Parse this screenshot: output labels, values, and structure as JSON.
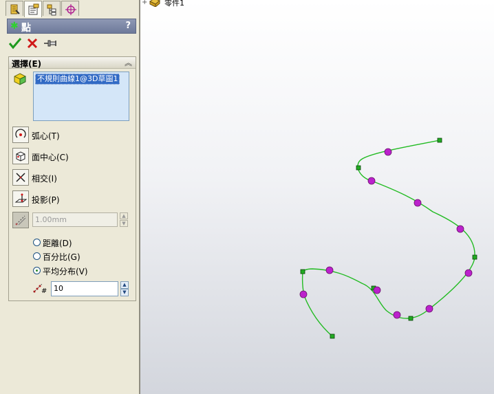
{
  "panel": {
    "tabs": [
      {
        "name": "feature-manager",
        "icon": "feature-manager-icon"
      },
      {
        "name": "property-manager",
        "icon": "property-manager-icon",
        "active": true
      },
      {
        "name": "configuration-manager",
        "icon": "configuration-manager-icon"
      },
      {
        "name": "dim-xpert-manager",
        "icon": "dim-xpert-icon"
      }
    ],
    "title": "點",
    "help": "?",
    "selection_group": {
      "title": "選擇(E)",
      "selected_item": "不規則曲線1@3D草圖1"
    },
    "options": [
      {
        "label": "弧心(T)",
        "icon": "arc-center-icon"
      },
      {
        "label": "面中心(C)",
        "icon": "face-center-icon"
      },
      {
        "label": "相交(I)",
        "icon": "intersection-icon"
      },
      {
        "label": "投影(P)",
        "icon": "projection-icon"
      }
    ],
    "distance": {
      "value": "1.00mm",
      "icon": "distance-along-curve-icon"
    },
    "radios": [
      {
        "label": "距離(D)",
        "checked": false
      },
      {
        "label": "百分比(G)",
        "checked": false
      },
      {
        "label": "平均分布(V)",
        "checked": true
      }
    ],
    "point_count": {
      "value": "10",
      "icon": "point-count-icon"
    }
  },
  "viewport": {
    "tree_item": "零件1",
    "curve_color": "#22bb22",
    "point_color": "#bb22cc",
    "handle_color": "#22aa22",
    "spline_handles_count": 7,
    "reference_points_count": 13
  }
}
